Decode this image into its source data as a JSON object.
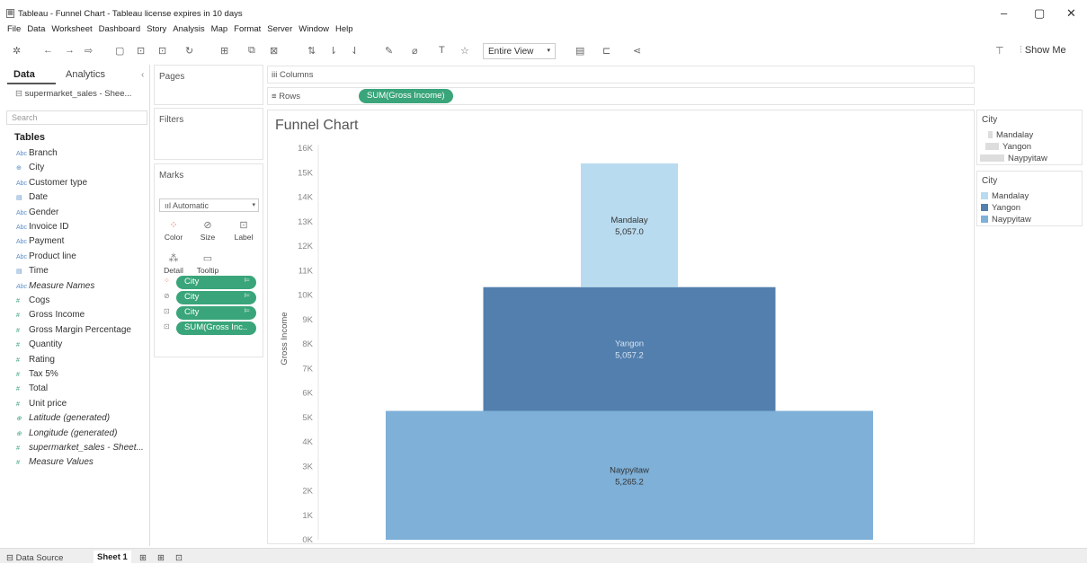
{
  "window": {
    "title": "Tableau - Funnel Chart - Tableau license expires in 10 days",
    "controls": [
      "–",
      "▢",
      "✕"
    ]
  },
  "menu": [
    "File",
    "Data",
    "Worksheet",
    "Dashboard",
    "Story",
    "Analysis",
    "Map",
    "Format",
    "Server",
    "Window",
    "Help"
  ],
  "toolbar": {
    "fit_dropdown": "Entire View",
    "show_me": "Show Me"
  },
  "data_pane": {
    "tab_data": "Data",
    "tab_analytics": "Analytics",
    "datasource": "supermarket_sales - Shee...",
    "search_placeholder": "Search",
    "tables_header": "Tables",
    "fields": [
      {
        "name": "Branch",
        "type": "dim",
        "icon": "Abc",
        "italic": false
      },
      {
        "name": "City",
        "type": "dim",
        "icon": "⊕",
        "italic": false
      },
      {
        "name": "Customer type",
        "type": "dim",
        "icon": "Abc",
        "italic": false
      },
      {
        "name": "Date",
        "type": "dim",
        "icon": "▤",
        "italic": false
      },
      {
        "name": "Gender",
        "type": "dim",
        "icon": "Abc",
        "italic": false
      },
      {
        "name": "Invoice ID",
        "type": "dim",
        "icon": "Abc",
        "italic": false
      },
      {
        "name": "Payment",
        "type": "dim",
        "icon": "Abc",
        "italic": false
      },
      {
        "name": "Product line",
        "type": "dim",
        "icon": "Abc",
        "italic": false
      },
      {
        "name": "Time",
        "type": "dim",
        "icon": "▤",
        "italic": false
      },
      {
        "name": "Measure Names",
        "type": "dim",
        "icon": "Abc",
        "italic": true
      },
      {
        "name": "Cogs",
        "type": "meas",
        "icon": "#",
        "italic": false
      },
      {
        "name": "Gross Income",
        "type": "meas",
        "icon": "#",
        "italic": false
      },
      {
        "name": "Gross Margin Percentage",
        "type": "meas",
        "icon": "#",
        "italic": false
      },
      {
        "name": "Quantity",
        "type": "meas",
        "icon": "#",
        "italic": false
      },
      {
        "name": "Rating",
        "type": "meas",
        "icon": "#",
        "italic": false
      },
      {
        "name": "Tax 5%",
        "type": "meas",
        "icon": "#",
        "italic": false
      },
      {
        "name": "Total",
        "type": "meas",
        "icon": "#",
        "italic": false
      },
      {
        "name": "Unit price",
        "type": "meas",
        "icon": "#",
        "italic": false
      },
      {
        "name": "Latitude (generated)",
        "type": "meas",
        "icon": "⊕",
        "italic": true
      },
      {
        "name": "Longitude (generated)",
        "type": "meas",
        "icon": "⊕",
        "italic": true
      },
      {
        "name": "supermarket_sales - Sheet...",
        "type": "meas",
        "icon": "#",
        "italic": true
      },
      {
        "name": "Measure Values",
        "type": "meas",
        "icon": "#",
        "italic": true
      }
    ]
  },
  "cards": {
    "pages": "Pages",
    "filters": "Filters",
    "marks": "Marks",
    "mark_type": "Automatic",
    "mark_buttons": [
      "Color",
      "Size",
      "Label",
      "Detail",
      "Tooltip"
    ],
    "mark_pills": [
      "City",
      "City",
      "City",
      "SUM(Gross Inc.."
    ]
  },
  "shelves": {
    "columns_label": "Columns",
    "rows_label": "Rows",
    "rows_pill": "SUM(Gross Income)"
  },
  "sheet_title": "Funnel Chart",
  "legends": [
    {
      "title": "City",
      "kind": "size",
      "items": [
        "Mandalay",
        "Yangon",
        "Naypyitaw"
      ]
    },
    {
      "title": "City",
      "kind": "color",
      "items": [
        "Mandalay",
        "Yangon",
        "Naypyitaw"
      ]
    }
  ],
  "colors": {
    "Mandalay": "#b9dbef",
    "Yangon": "#527fae",
    "Naypyitaw": "#7eb0d8",
    "pill_green": "#3aa57a"
  },
  "chart_data": {
    "type": "bar",
    "stacked": true,
    "ylabel": "Gross Income",
    "ylim": [
      0,
      16000
    ],
    "yticks": [
      "0K",
      "1K",
      "2K",
      "3K",
      "4K",
      "5K",
      "6K",
      "7K",
      "8K",
      "9K",
      "10K",
      "11K",
      "12K",
      "13K",
      "14K",
      "15K",
      "16K"
    ],
    "series": [
      {
        "name": "Naypyitaw",
        "value": 5265.2,
        "label": "5,265.2",
        "size_rank": 3
      },
      {
        "name": "Yangon",
        "value": 5057.2,
        "label": "5,057.2",
        "size_rank": 2
      },
      {
        "name": "Mandalay",
        "value": 5057.0,
        "label": "5,057.0",
        "size_rank": 1
      }
    ],
    "grid": false
  },
  "status": {
    "datasource_tab": "Data Source",
    "sheet_tab": "Sheet 1"
  }
}
